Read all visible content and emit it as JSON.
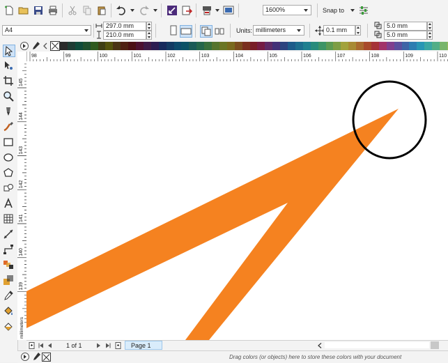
{
  "toolbar": {
    "zoom_value": "1600%",
    "snap_label": "Snap to"
  },
  "property_bar": {
    "page_size": "A4",
    "width": "297.0 mm",
    "height": "210.0 mm",
    "units_label": "Units:",
    "units_value": "millimeters",
    "nudge_value": "0.1 mm",
    "dup_x": "5.0 mm",
    "dup_y": "5.0 mm"
  },
  "rulers": {
    "horizontal_ticks": [
      "98",
      "99",
      "100",
      "101",
      "102",
      "103",
      "104",
      "105",
      "106",
      "107",
      "108",
      "109",
      "110"
    ],
    "vertical_ticks": [
      "145",
      "144",
      "143",
      "142",
      "141",
      "140",
      "139"
    ],
    "unit_label": "millimeters"
  },
  "page_nav": {
    "page_count": "1 of 1",
    "page_tab": "Page 1"
  },
  "status": {
    "palette_hint": "Drag colors (or objects) here to store these colors with your document"
  },
  "palette": [
    "#2b2b2b",
    "#1e3b33",
    "#0f4a3a",
    "#1f4f2e",
    "#2f5a1f",
    "#3f3f14",
    "#54530d",
    "#4a3415",
    "#4f2013",
    "#4b1014",
    "#4d1230",
    "#3f1c46",
    "#2c1d51",
    "#162a5c",
    "#123a63",
    "#0d4a6b",
    "#0b5166",
    "#1a5a56",
    "#24664a",
    "#386f3b",
    "#55742e",
    "#6b7625",
    "#7a6a1e",
    "#7b4d1e",
    "#7a3020",
    "#781d27",
    "#741c44",
    "#5e2a66",
    "#433077",
    "#2c447f",
    "#1d5c8a",
    "#1d6e8e",
    "#1f8090",
    "#288b7c",
    "#3d9466",
    "#5c9a52",
    "#7d9d45",
    "#a2a23c",
    "#a88a34",
    "#a96a2f",
    "#a84a2b",
    "#a53338",
    "#a2336a",
    "#7f3f8f",
    "#5b4f9e",
    "#3f64a6",
    "#2c7db1",
    "#2896b4",
    "#3aa6a3",
    "#52ae87",
    "#78b56c",
    "#9fba5c"
  ],
  "shape": {
    "fill": "#f58220",
    "highlight_stroke": "#000000"
  }
}
